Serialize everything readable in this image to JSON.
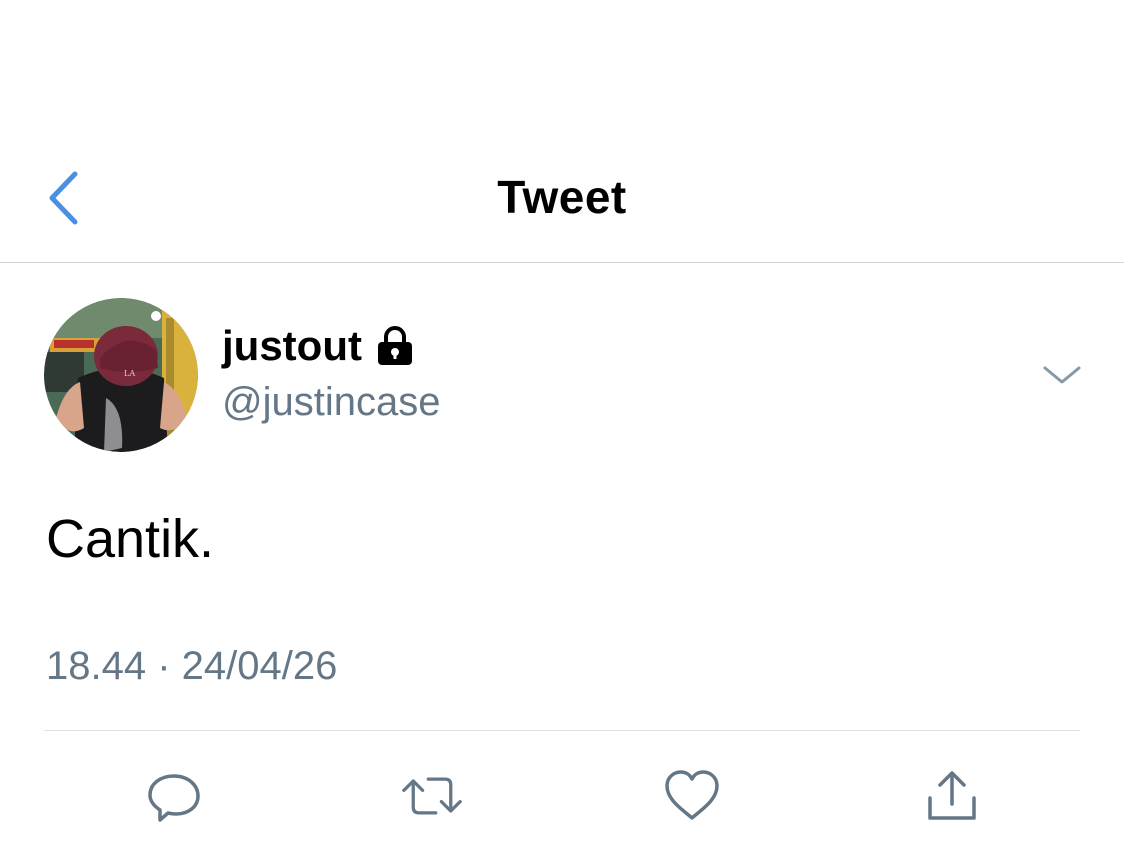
{
  "header": {
    "title": "Tweet",
    "back_icon": "chevron-left-icon",
    "accent_color": "#4a90e2"
  },
  "tweet": {
    "display_name": "justout",
    "protected_icon": "lock-icon",
    "handle": "@justincase",
    "text": "Cantik.",
    "timestamp": "18.44 · 24/04/26",
    "more_icon": "chevron-down-icon"
  },
  "actions": [
    {
      "icon": "reply-icon"
    },
    {
      "icon": "retweet-icon"
    },
    {
      "icon": "like-icon"
    },
    {
      "icon": "share-icon"
    }
  ],
  "colors": {
    "text_primary": "#000000",
    "text_secondary": "#657786",
    "divider": "#cfd6dc",
    "icon_gray": "#657786"
  }
}
